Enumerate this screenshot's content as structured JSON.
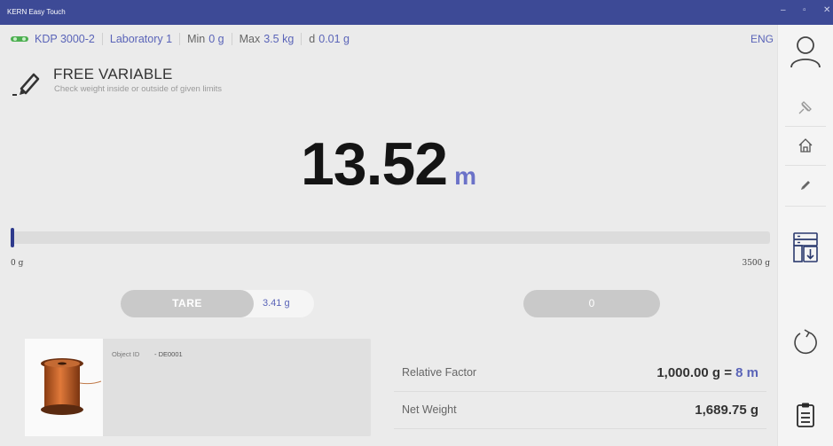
{
  "window": {
    "title": "KERN Easy Touch",
    "minimize_glyph": "–",
    "maximize_glyph": "▫",
    "close_glyph": "✕"
  },
  "device": {
    "model": "KDP 3000-2",
    "location": "Laboratory 1",
    "min_label": "Min",
    "min_value": "0 g",
    "max_label": "Max",
    "max_value": "3.5 kg",
    "d_label": "d",
    "d_value": "0.01 g",
    "icon": "scale-status-icon"
  },
  "language": "ENG",
  "app": {
    "title": "FREE VARIABLE",
    "subtitle": "Check weight inside or outside of given limits",
    "icon": "pencil-icon"
  },
  "reading": {
    "value": "13.52",
    "unit": "m"
  },
  "load_bar": {
    "min_label": "0 g",
    "max_label": "3500 g",
    "fill_fraction": 0.005
  },
  "tare": {
    "label": "TARE",
    "value": "3.41 g"
  },
  "zero": {
    "label": "0"
  },
  "object": {
    "id_label": "Object ID",
    "id_value": "- DE0001",
    "image": "copper-wire-spool"
  },
  "factors": [
    {
      "label": "Relative Factor",
      "value_main": "1,000.00 g = ",
      "value_highlight": "8 m"
    },
    {
      "label": "Net Weight",
      "value_main": "1,689.75 g",
      "value_highlight": ""
    }
  ],
  "sidebar": {
    "items": [
      {
        "name": "user-icon"
      },
      {
        "name": "pin-icon"
      },
      {
        "name": "home-icon"
      },
      {
        "name": "edit-icon"
      },
      {
        "name": "data-transfer-icon"
      },
      {
        "name": "refresh-icon"
      },
      {
        "name": "clipboard-icon"
      }
    ]
  },
  "colors": {
    "titlebar": "#3d4a96",
    "accent": "#5a64b8",
    "bar_fill": "#2e3a8c",
    "status_green": "#4caf50"
  }
}
